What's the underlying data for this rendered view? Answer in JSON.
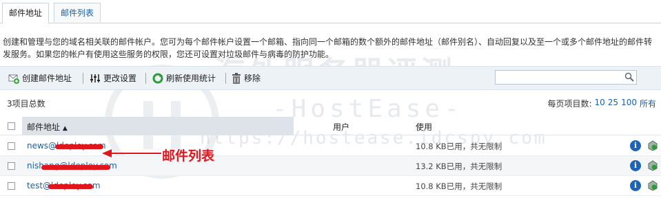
{
  "tabs": [
    {
      "label": "邮件地址",
      "active": true
    },
    {
      "label": "邮件列表",
      "active": false
    }
  ],
  "description": "创建和管理与您的域名相关联的邮件帐户。您可为每个邮件帐户设置一个邮箱、指向同一个邮箱的数个额外的邮件地址（邮件别名）、自动回复以及至一个或多个邮件地址的邮件转发服务。如果您的帐户有使用这些服务的权限，您还可设置对垃圾邮件与病毒的防护功能。",
  "toolbar": {
    "create_label": "创建邮件地址",
    "settings_label": "更改设置",
    "refresh_label": "刷新使用统计",
    "remove_label": "移除"
  },
  "list": {
    "total_label": "3项目总数",
    "per_page_label": "每页项目数:",
    "per_page_options": [
      "10",
      "25",
      "100",
      "所有"
    ]
  },
  "table": {
    "columns": {
      "email": "邮件地址",
      "user": "用户",
      "usage": "使用"
    },
    "rows": [
      {
        "email": "news@ldeploy.com",
        "usage": "10.8 KB已用，共无限制"
      },
      {
        "email": "nishang@ldeploy.com",
        "usage": "13.2 KB已用，共无限制"
      },
      {
        "email": "test@ldeploy.com",
        "usage": "10.8 KB已用，共无限制"
      }
    ]
  },
  "annotation": "邮件列表",
  "watermark": {
    "title": "海外服务器评测",
    "brand": "-HostEase-",
    "url": "https://hostease.idcspy.com"
  },
  "colors": {
    "accent_link": "#1a5fa8",
    "annotation_red": "#e0161c",
    "toolbar_bg": "#edf2f7"
  }
}
